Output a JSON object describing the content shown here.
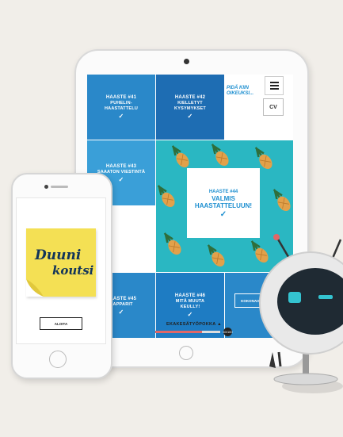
{
  "colors": {
    "blue_dark": "#1e7cc3",
    "blue_mid": "#2a88c9",
    "blue_light": "#3a9fd8",
    "teal": "#2ab7c2",
    "pineapple": "#e2a14a",
    "leaf": "#2f6e3b",
    "accent_red": "#e06767"
  },
  "tablet": {
    "tiles": [
      {
        "num": "HAASTE #41",
        "label": "PUHELIN-\nHAASTATTELU",
        "check": "✓"
      },
      {
        "num": "HAASTE #42",
        "label": "KIELLETYT\nKYSYMYKSET",
        "check": "✓"
      },
      {
        "num": "HAASTE #43",
        "label": "SAAATON VIESTINTÄ",
        "check": "✓"
      },
      {
        "num": "HAASTE #45",
        "label": "HAPPARIT",
        "check": "✓"
      },
      {
        "num": "HAASTE #46",
        "label": "MITÄ MUUTA\nKEULLY!",
        "check": "✓"
      }
    ],
    "center_card": {
      "num": "HAASTE #44",
      "line1": "VALMIS",
      "line2": "HAASTATTELUUN!",
      "check": "✓"
    },
    "script_text": "PIDÄ KIIN\nOIKEUKSI...",
    "menu_icon": "hamburger-icon",
    "cv_label": "CV",
    "koko_button": "KOKONAISUUS",
    "progress": {
      "label": "EKAKESÄTYÖPOKKA ▲",
      "fraction": 0.72,
      "dot_label": "60/100"
    }
  },
  "phone": {
    "logo_line1": "Duuni",
    "logo_line2": "koutsi",
    "button": "ALOITA"
  }
}
